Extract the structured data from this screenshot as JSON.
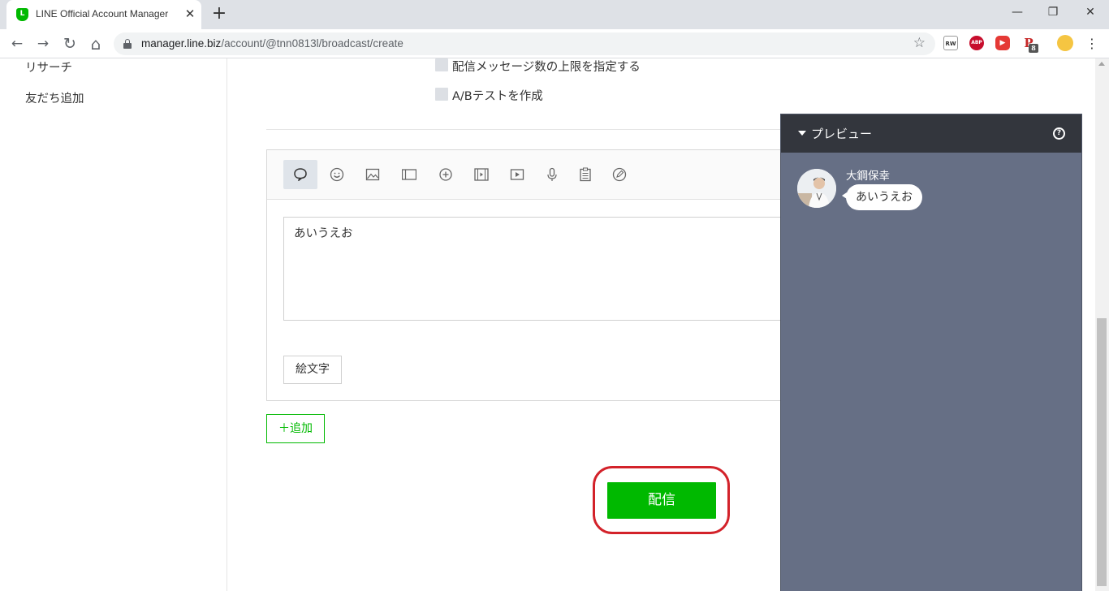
{
  "browser": {
    "tab_title": "LINE Official Account Manager",
    "tab_favicon_text": "L",
    "tab_close": "✕",
    "new_tab": "+",
    "url_host": "manager.line.biz",
    "url_path": "/account/@tnn0813l/broadcast/create",
    "nav": {
      "back": "←",
      "forward": "→",
      "reload": "↻",
      "home": "⌂"
    },
    "window": {
      "minimize": "—",
      "restore": "❐",
      "close": "✕"
    },
    "star": "☆",
    "extensions": [
      {
        "name": "rw-extension-icon",
        "text": "RW",
        "color": "#ffffff"
      },
      {
        "name": "adblock-plus-icon",
        "text": "ABP",
        "color": "#c70d2c"
      },
      {
        "name": "video-extension-icon",
        "text": "▶",
        "color": "#e53935"
      },
      {
        "name": "p-extension-icon",
        "text": "P",
        "color": "#ffffff",
        "badge": "8"
      },
      {
        "name": "profile-avatar-icon",
        "text": "",
        "color": "#f5c542"
      }
    ],
    "menu": "⋮"
  },
  "sidebar": {
    "items": [
      "リサーチ",
      "友だち追加"
    ]
  },
  "options": {
    "limit_label": "配信メッセージ数の上限を指定する",
    "ab_test_label": "A/Bテストを作成"
  },
  "editor": {
    "toolbar_icons": [
      "text-bubble-icon",
      "sticker-icon",
      "image-icon",
      "coupon-icon",
      "richmessage-icon",
      "richvideo-icon",
      "video-icon",
      "voice-icon",
      "survey-icon",
      "card-icon"
    ],
    "message_text": "あいうえお",
    "emoji_button": "絵文字"
  },
  "add_button": "＋追加",
  "send_button": "配信",
  "colors": {
    "line_green": "#00b900",
    "highlight_red": "#d3222a",
    "preview_bg": "#666f85",
    "preview_header": "#33363d"
  },
  "preview": {
    "title": "プレビュー",
    "help": "?",
    "sender_name": "大鋼保幸",
    "message": "あいうえお"
  }
}
